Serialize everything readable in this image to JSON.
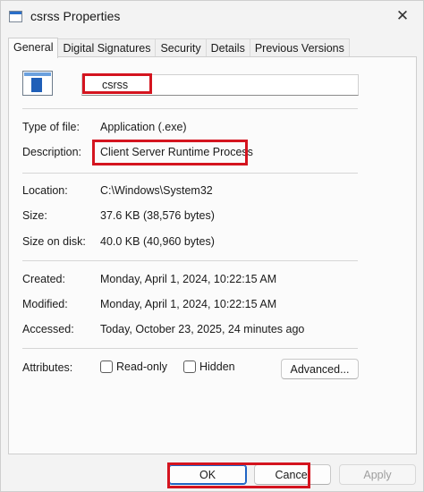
{
  "window": {
    "title": "csrss Properties",
    "close_glyph": "✕"
  },
  "tabs": [
    {
      "label": "General",
      "active": true
    },
    {
      "label": "Digital Signatures",
      "active": false
    },
    {
      "label": "Security",
      "active": false
    },
    {
      "label": "Details",
      "active": false
    },
    {
      "label": "Previous Versions",
      "active": false
    }
  ],
  "general": {
    "file_name": "csrss",
    "type_label": "Type of file:",
    "type_value": "Application (.exe)",
    "description_label": "Description:",
    "description_value": "Client Server Runtime Process",
    "location_label": "Location:",
    "location_value": "C:\\Windows\\System32",
    "size_label": "Size:",
    "size_value": "37.6 KB (38,576 bytes)",
    "size_on_disk_label": "Size on disk:",
    "size_on_disk_value": "40.0 KB (40,960 bytes)",
    "created_label": "Created:",
    "created_value": "Monday, April 1, 2024, 10:22:15 AM",
    "modified_label": "Modified:",
    "modified_value": "Monday, April 1, 2024, 10:22:15 AM",
    "accessed_label": "Accessed:",
    "accessed_value": "Today, October 23, 2025, 24 minutes ago",
    "attributes_label": "Attributes:",
    "readonly_label": "Read-only",
    "hidden_label": "Hidden",
    "advanced_label": "Advanced..."
  },
  "footer": {
    "ok_label": "OK",
    "cancel_label": "Cancel",
    "apply_label": "Apply"
  },
  "colors": {
    "highlight": "#d4141f",
    "accent": "#1f64c4"
  }
}
